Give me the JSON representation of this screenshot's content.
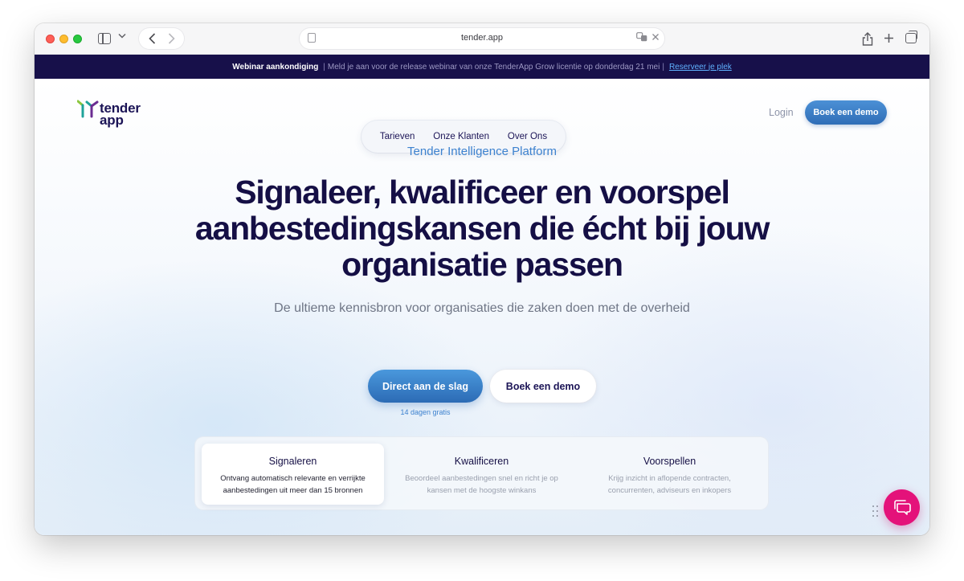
{
  "browser": {
    "url": "tender.app"
  },
  "announcement": {
    "label": "Webinar aankondiging",
    "message": "Meld je aan voor de release webinar van onze TenderApp Grow licentie op donderdag 21 mei",
    "separator": "|",
    "link": "Reserveer je plek"
  },
  "header": {
    "logo_text": "tender app",
    "nav": [
      "Tarieven",
      "Onze Klanten",
      "Over Ons"
    ],
    "login": "Login",
    "demo_button": "Boek een demo"
  },
  "hero": {
    "eyebrow": "Tender Intelligence Platform",
    "headline": "Signaleer, kwalificeer en voorspel aanbestedingskansen die écht bij jouw organisatie passen",
    "subline": "De ultieme kennisbron voor organisaties die zaken doen met de overheid",
    "cta_primary": "Direct aan de slag",
    "cta_secondary": "Boek een demo",
    "trial_note": "14 dagen gratis"
  },
  "features": [
    {
      "title": "Signaleren",
      "description": "Ontvang automatisch relevante en verrijkte aanbestedingen uit meer dan 15 bronnen",
      "active": true
    },
    {
      "title": "Kwalificeren",
      "description": "Beoordeel aanbestedingen snel en richt je op kansen met de hoogste winkans",
      "active": false
    },
    {
      "title": "Voorspellen",
      "description": "Krijg inzicht in aflopende contracten, concurrenten, adviseurs en inkopers",
      "active": false
    }
  ],
  "colors": {
    "brand_navy": "#150f45",
    "accent_blue": "#3d82cf",
    "chat_pink": "#e4127a",
    "logo_green": "#8cc63f",
    "logo_teal": "#1fa39a",
    "logo_purple": "#6a2c91"
  },
  "icons": [
    "sidebar-icon",
    "chevron-down-icon",
    "back-icon",
    "forward-icon",
    "page-icon",
    "translate-icon",
    "close-icon",
    "share-icon",
    "new-tab-icon",
    "tabs-overview-icon",
    "drag-handle-icon",
    "chat-icon"
  ]
}
